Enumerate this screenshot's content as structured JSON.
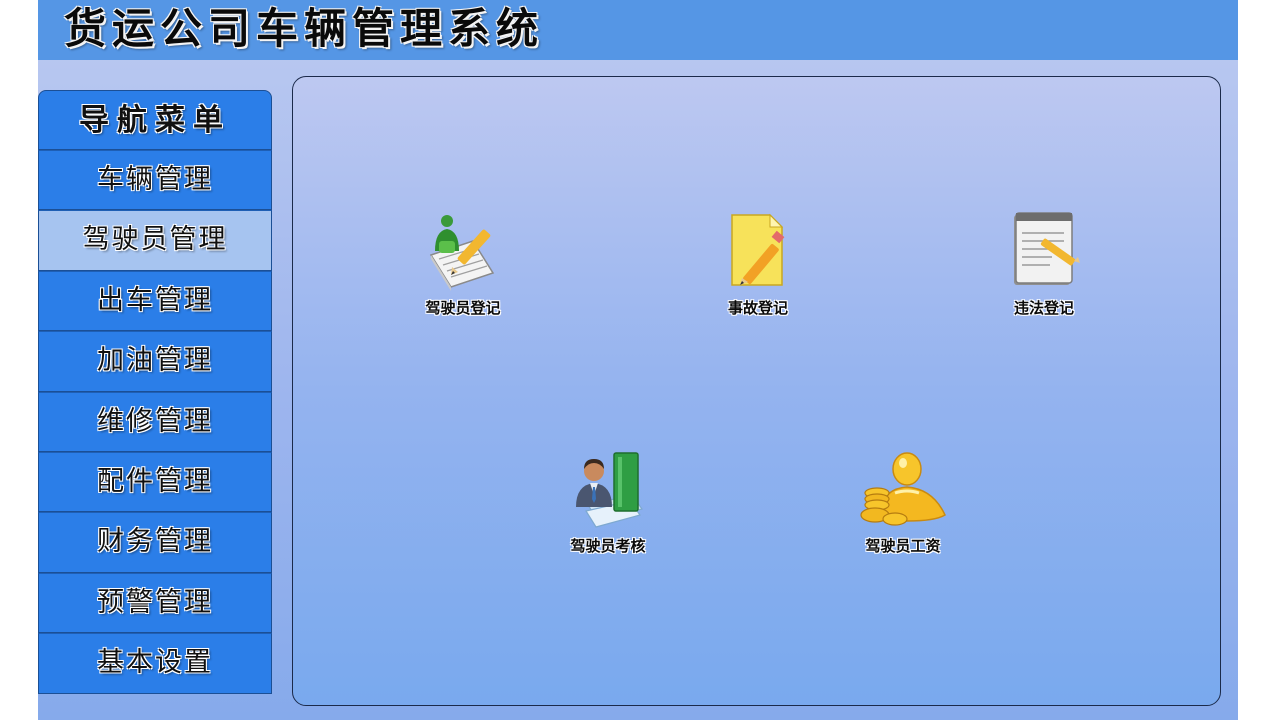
{
  "app": {
    "title": "货运公司车辆管理系统"
  },
  "nav": {
    "header": "导航菜单",
    "items": [
      {
        "label": "车辆管理"
      },
      {
        "label": "驾驶员管理",
        "active": true
      },
      {
        "label": "出车管理"
      },
      {
        "label": "加油管理"
      },
      {
        "label": "维修管理"
      },
      {
        "label": "配件管理"
      },
      {
        "label": "财务管理"
      },
      {
        "label": "预警管理"
      },
      {
        "label": "基本设置"
      }
    ]
  },
  "tiles": [
    {
      "label": "驾驶员登记",
      "icon": "driver-register-icon"
    },
    {
      "label": "事故登记",
      "icon": "accident-note-icon"
    },
    {
      "label": "违法登记",
      "icon": "violation-notepad-icon"
    },
    {
      "label": "驾驶员考核",
      "icon": "driver-assessment-icon"
    },
    {
      "label": "驾驶员工资",
      "icon": "salary-coins-icon"
    }
  ],
  "colors": {
    "titlebar": "#5596e5",
    "nav_item": "#2b7ee8",
    "nav_active": "#a6c4f0"
  }
}
